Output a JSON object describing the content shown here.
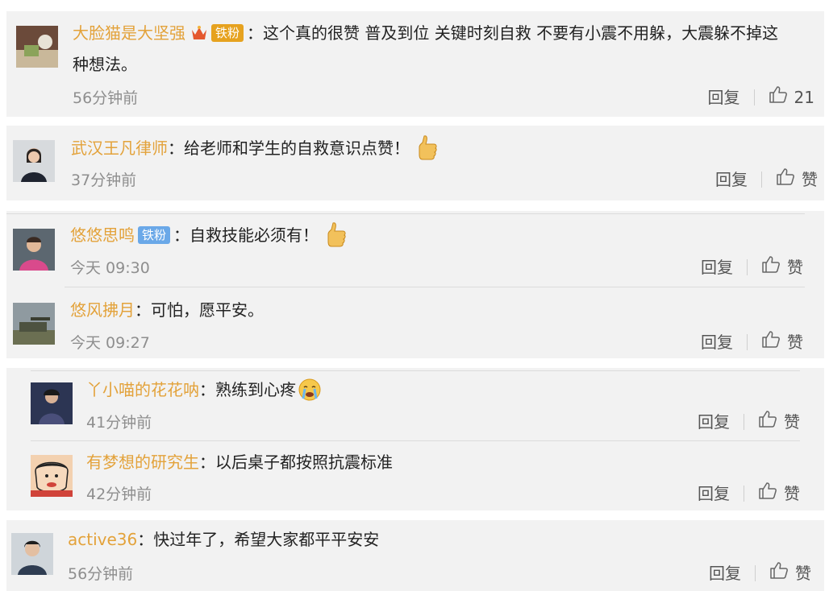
{
  "comments": [
    {
      "name": "大脸猫是大坚强",
      "badge": "铁粉",
      "text_line1": "这个真的很赞 普及到位 关键时刻自救 不要有小震不用躲，大震躲不掉这",
      "text_line2": "种想法。",
      "time": "56分钟前",
      "reply": "回复",
      "likes": "21"
    },
    {
      "name": "武汉王凡律师",
      "text": "给老师和学生的自救意识点赞！",
      "time": "37分钟前",
      "reply": "回复",
      "likes": "赞"
    },
    {
      "name": "悠悠思鸣",
      "badge": "铁粉",
      "text": "自救技能必须有！",
      "time": "今天 09:30",
      "reply": "回复",
      "likes": "赞"
    },
    {
      "name": "悠风拂月",
      "text": "可怕，愿平安。",
      "time": "今天 09:27",
      "reply": "回复",
      "likes": "赞"
    },
    {
      "name": "丫小喵的花花呐",
      "text": "熟练到心疼",
      "time": "41分钟前",
      "reply": "回复",
      "likes": "赞"
    },
    {
      "name": "有梦想的研究生",
      "text": "以后桌子都按照抗震标准",
      "time": "42分钟前",
      "reply": "回复",
      "likes": "赞"
    },
    {
      "name": "active36",
      "text": "快过年了，希望大家都平平安安",
      "time": "56分钟前",
      "reply": "回复",
      "likes": "赞"
    }
  ],
  "colon": "：",
  "colors": {
    "username": "#e3a23a",
    "panel_background": "#f2f2f2",
    "badge_gold": "#e6a21f",
    "badge_blue": "#6aa8e8",
    "timestamp": "#8e8e8e"
  },
  "icons": [
    "crown-icon",
    "thumbs-up-emoji-icon",
    "crying-emoji-icon",
    "like-icon"
  ]
}
